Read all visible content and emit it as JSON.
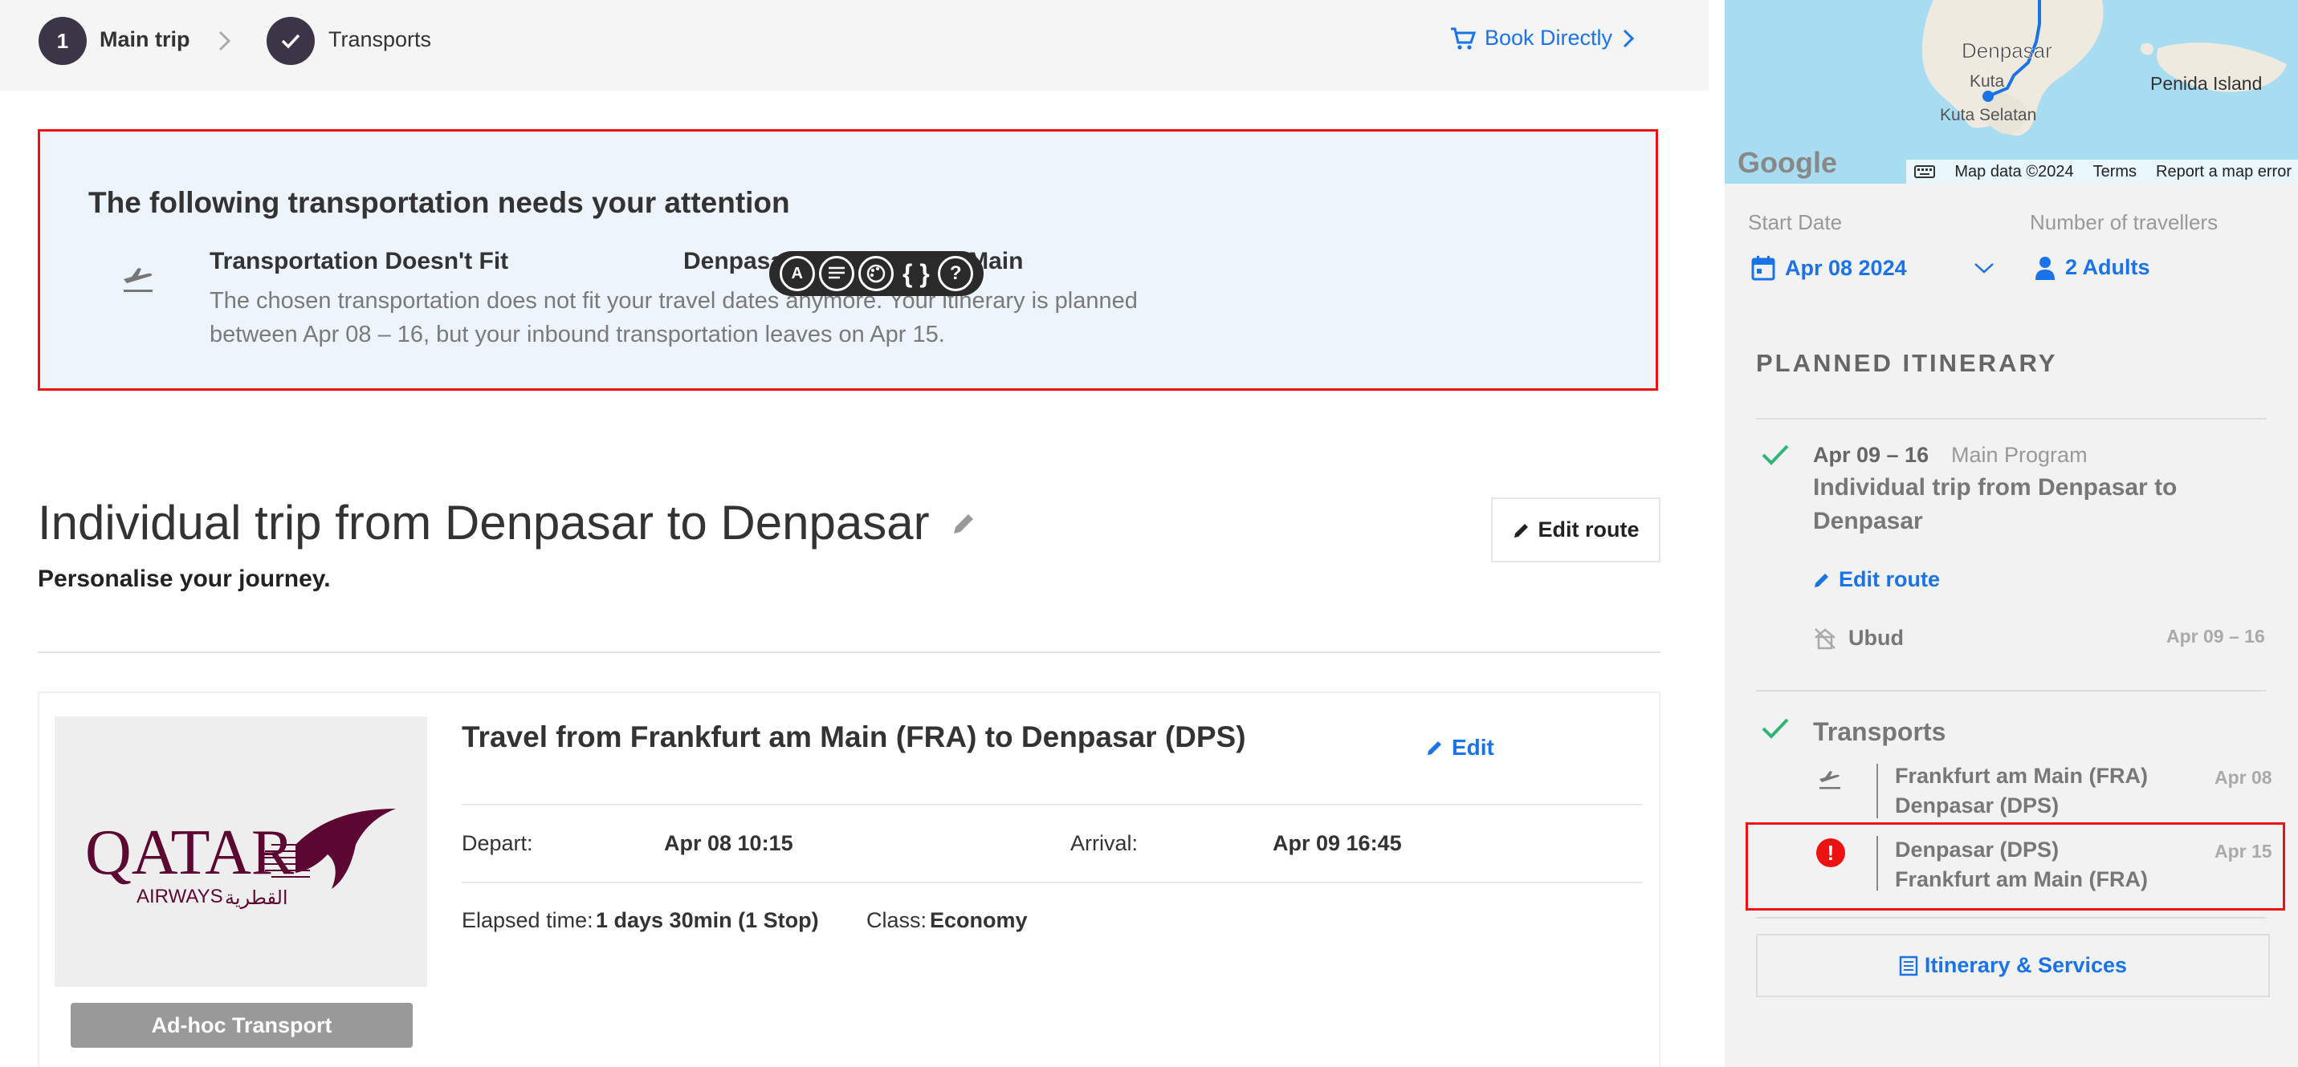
{
  "stepper": {
    "step1_number": "1",
    "step1_label": "Main trip",
    "step2_label": "Transports",
    "book_directly": "Book Directly"
  },
  "alert": {
    "title": "The following transportation needs your attention",
    "issue": "Transportation Doesn't Fit",
    "route": "Denpasar - Frankfurt am Main",
    "description": "The chosen transportation does not fit your travel dates anymore. Your itinerary is planned between Apr 08 – 16, but your inbound transportation leaves on Apr 15."
  },
  "devbar": {
    "items": [
      "translate-icon",
      "text-align-icon",
      "palette-icon",
      "{ }",
      "?"
    ]
  },
  "trip": {
    "title": "Individual trip from Denpasar to Denpasar",
    "subtitle": "Personalise your journey.",
    "edit_route": "Edit route"
  },
  "transport_card": {
    "logo_text": "QATAR",
    "logo_sub": "AIRWAYS",
    "logo_arabic": "القطرية",
    "adhoc": "Ad-hoc Transport",
    "title": "Travel from Frankfurt am Main (FRA) to Denpasar (DPS)",
    "edit": "Edit",
    "depart_label": "Depart:",
    "depart_value": "Apr 08 10:15",
    "arrival_label": "Arrival:",
    "arrival_value": "Apr 09 16:45",
    "elapsed_label": "Elapsed time:",
    "elapsed_value": "1 days 30min (1 Stop)",
    "class_label": "Class:",
    "class_value": "Economy"
  },
  "map": {
    "labels": {
      "denpasar": "Denpasar",
      "kuta": "Kuta",
      "kuta_selatan": "Kuta Selatan",
      "penida": "Penida Island"
    },
    "google": "Google",
    "map_data": "Map data ©2024",
    "terms": "Terms",
    "report": "Report a map error"
  },
  "sidebar": {
    "start_date_label": "Start Date",
    "start_date_value": "Apr 08 2024",
    "travellers_label": "Number of travellers",
    "travellers_value": "2 Adults",
    "planned_heading": "PLANNED ITINERARY",
    "program_dates": "Apr 09 – 16",
    "program_label": "Main Program",
    "program_name": "Individual trip from Denpasar to Denpasar",
    "edit_route": "Edit route",
    "city": "Ubud",
    "city_dates": "Apr 09 – 16",
    "transports_heading": "Transports",
    "transports": [
      {
        "from": "Frankfurt am Main (FRA)",
        "to": "Denpasar (DPS)",
        "date": "Apr 08"
      },
      {
        "from": "Denpasar (DPS)",
        "to": "Frankfurt am Main (FRA)",
        "date": "Apr 15"
      }
    ],
    "itinerary_services": "Itinerary & Services"
  },
  "colors": {
    "accent": "#1a73e8",
    "dark": "#3b3547",
    "error": "#ee1111",
    "success": "#2fb57a"
  }
}
